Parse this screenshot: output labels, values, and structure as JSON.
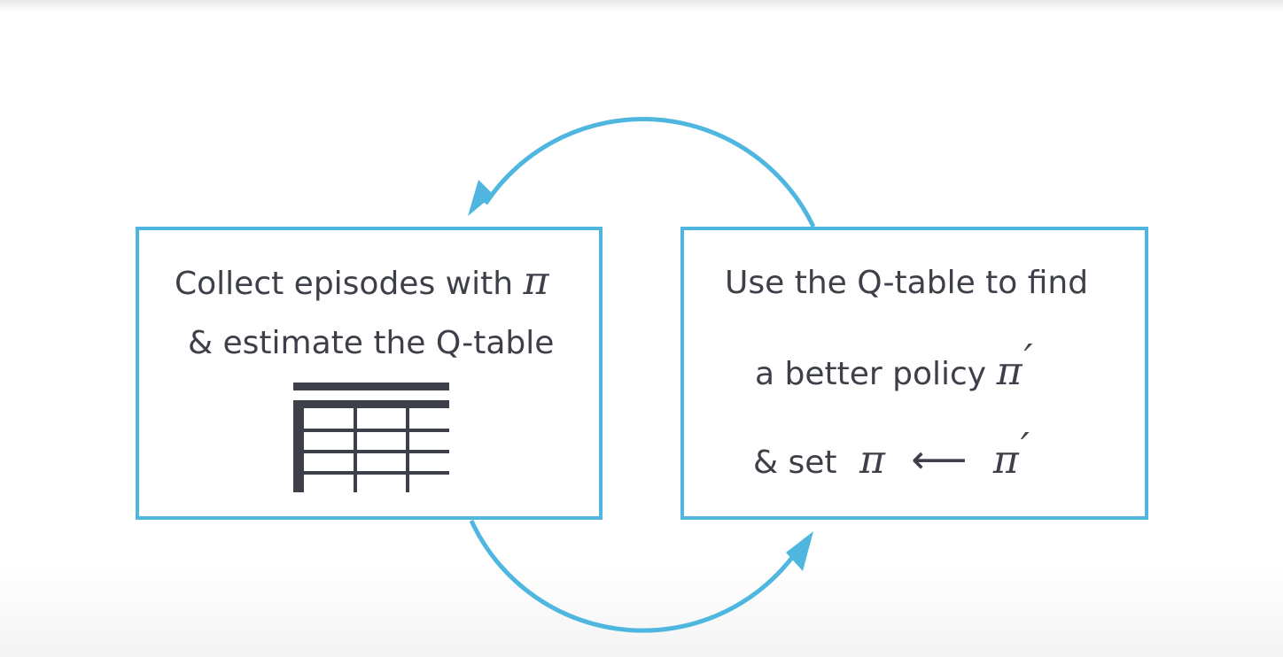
{
  "diagram": {
    "left_box": {
      "line1_text": "Collect episodes with",
      "line1_symbol": "π",
      "line2_text": "& estimate the Q-table",
      "icon": "table-icon"
    },
    "right_box": {
      "line1_text": "Use the Q-table to find",
      "line2_text": "a better policy",
      "line2_symbol": "π",
      "line2_prime": "′",
      "line3_text": "& set",
      "line3_symbol_left": "π",
      "line3_arrow": "⟵",
      "line3_symbol_right": "π",
      "line3_prime": "′"
    },
    "arrows": {
      "color": "#4fb7df",
      "top_arrow": "curved-arrow-right-to-left",
      "bottom_arrow": "curved-arrow-left-to-right"
    },
    "colors": {
      "box_border": "#4fb7df",
      "text": "#3d4049"
    }
  }
}
